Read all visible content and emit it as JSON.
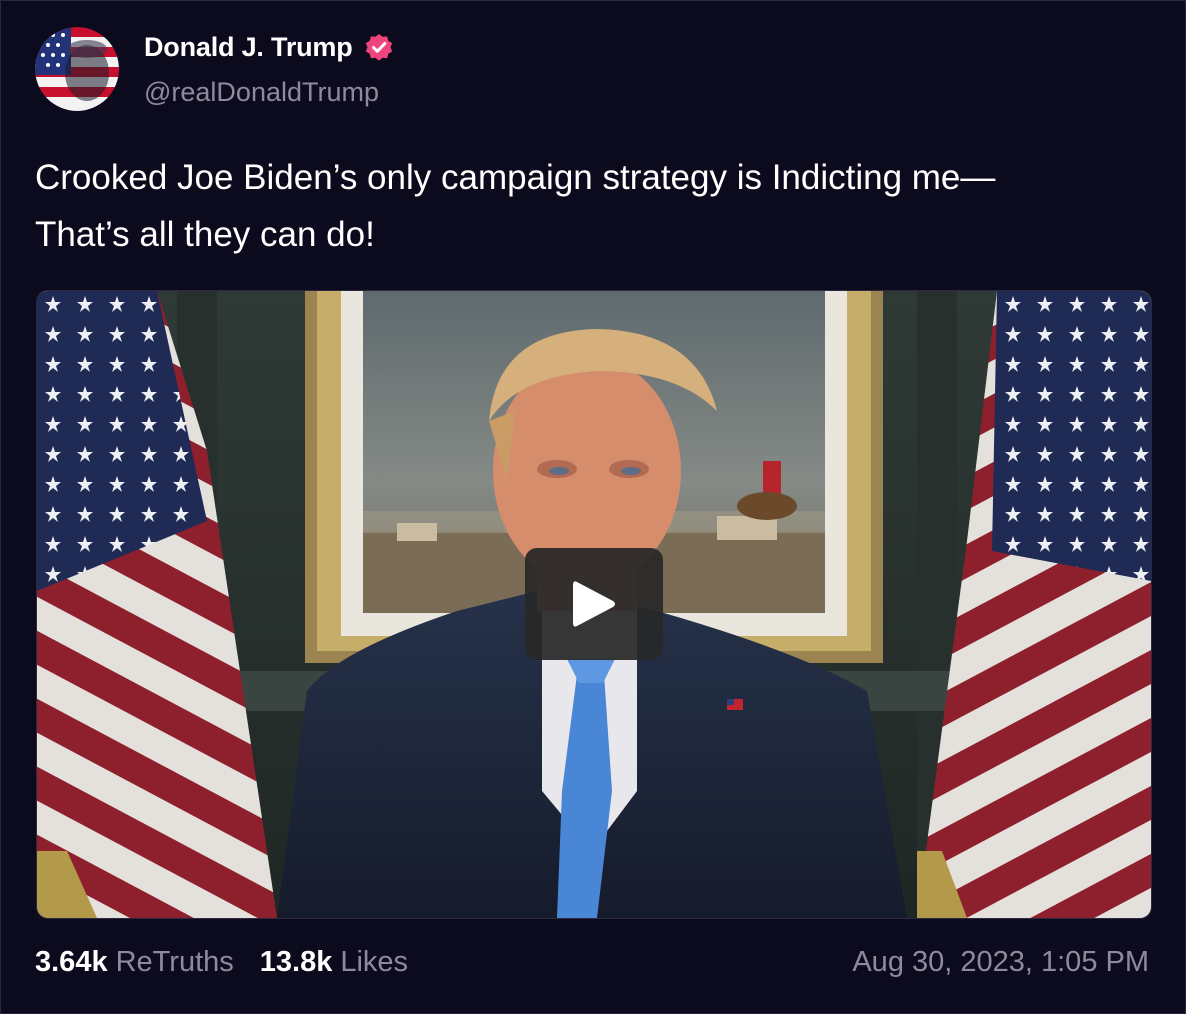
{
  "author": {
    "display_name": "Donald J. Trump",
    "handle": "@realDonaldTrump",
    "verified_icon": "verified-badge-icon",
    "verified_color": "#f0447c"
  },
  "post": {
    "text_line1": "Crooked Joe Biden’s only campaign strategy is Indicting me—",
    "text_line2": "That’s all they can do!"
  },
  "media": {
    "type": "video",
    "play_icon": "play-icon"
  },
  "stats": {
    "retruths_count": "3.64k",
    "retruths_label": "ReTruths",
    "likes_count": "13.8k",
    "likes_label": "Likes",
    "timestamp": "Aug 30, 2023, 1:05 PM"
  },
  "colors": {
    "background": "#0c0a1d",
    "muted_text": "#8c8a9c",
    "text": "#ffffff"
  }
}
